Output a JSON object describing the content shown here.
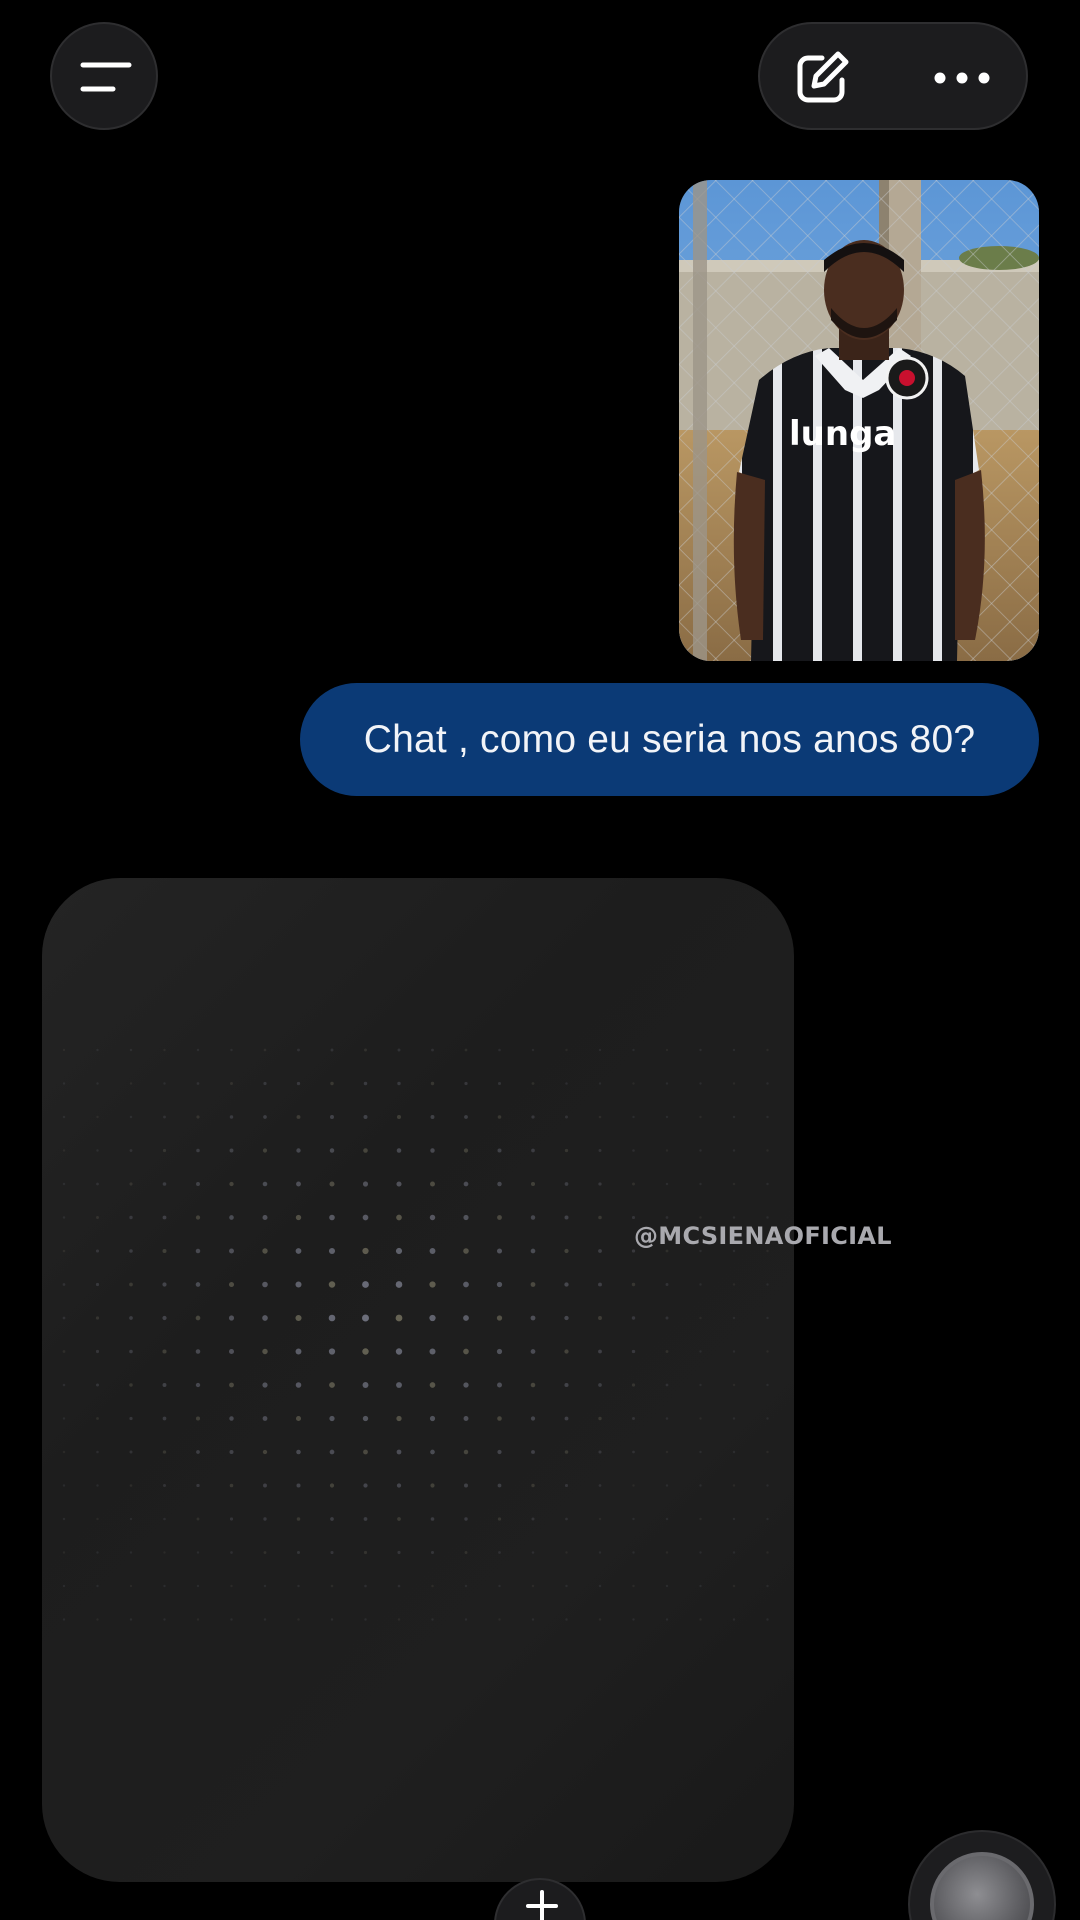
{
  "header": {
    "menu_icon": "menu-icon",
    "edit_icon": "edit-icon",
    "more_icon": "more-horizontal-icon"
  },
  "conversation": {
    "attachment": {
      "type": "photo",
      "jersey_text": "lunga"
    },
    "user_message": "Chat , como eu seria nos anos 80?",
    "assistant_state": "generating-image"
  },
  "watermark": "@MCSIENAOFICIAL",
  "bottom_bar": {
    "plus_icon": "plus-icon",
    "voice_icon": "voice-orb-icon"
  },
  "colors": {
    "background": "#000000",
    "user_bubble": "#0b3a76",
    "card": "#1f1f1f"
  }
}
